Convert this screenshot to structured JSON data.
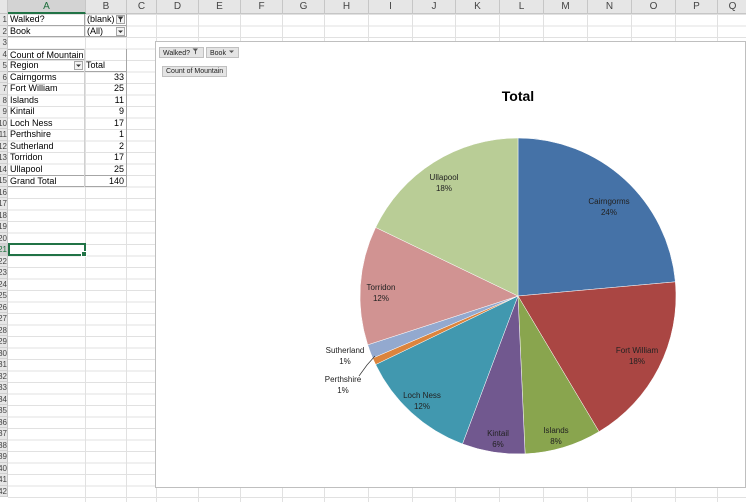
{
  "sheet": {
    "columns": [
      "A",
      "B",
      "C",
      "D",
      "E",
      "F",
      "G",
      "H",
      "I",
      "J",
      "K",
      "L",
      "M",
      "N",
      "O",
      "P",
      "Q"
    ],
    "selected_column": "A",
    "row_numbers": [
      "1",
      "2",
      "3",
      "4",
      "5",
      "6",
      "7",
      "8",
      "9",
      "10",
      "11",
      "12",
      "13",
      "14",
      "15",
      "16",
      "17",
      "18",
      "19",
      "20",
      "21",
      "22",
      "23",
      "24",
      "25",
      "26",
      "27",
      "28",
      "29",
      "30",
      "31",
      "32",
      "33",
      "34",
      "35",
      "36",
      "37",
      "38",
      "39",
      "40",
      "41",
      "42"
    ],
    "selected_row": "21"
  },
  "pivot": {
    "filters": [
      {
        "label": "Walked?",
        "value": "(blank)",
        "icon": "filter-funnel-icon"
      },
      {
        "label": "Book",
        "value": "(All)",
        "icon": "dropdown-arrow-icon"
      }
    ],
    "value_header": "Count of Mountain",
    "row_header": "Region",
    "total_header": "Total",
    "rows": [
      {
        "region": "Cairngorms",
        "total": "33"
      },
      {
        "region": "Fort William",
        "total": "25"
      },
      {
        "region": "Islands",
        "total": "11"
      },
      {
        "region": "Kintail",
        "total": "9"
      },
      {
        "region": "Loch Ness",
        "total": "17"
      },
      {
        "region": "Perthshire",
        "total": "1"
      },
      {
        "region": "Sutherland",
        "total": "2"
      },
      {
        "region": "Torridon",
        "total": "17"
      },
      {
        "region": "Ullapool",
        "total": "25"
      }
    ],
    "grand_total_label": "Grand Total",
    "grand_total": "140"
  },
  "chart": {
    "field_buttons": {
      "walked": "Walked?",
      "book": "Book",
      "values": "Count of Mountain"
    }
  },
  "chart_data": {
    "type": "pie",
    "title": "Total",
    "categories": [
      "Cairngorms",
      "Fort William",
      "Islands",
      "Kintail",
      "Loch Ness",
      "Perthshire",
      "Sutherland",
      "Torridon",
      "Ullapool"
    ],
    "values": [
      33,
      25,
      11,
      9,
      17,
      1,
      2,
      17,
      25
    ],
    "percent_labels": [
      "24%",
      "18%",
      "8%",
      "6%",
      "12%",
      "1%",
      "1%",
      "12%",
      "18%"
    ],
    "colors": [
      "#4572a7",
      "#aa4643",
      "#89a54e",
      "#71588f",
      "#4198af",
      "#db843d",
      "#93a9cf",
      "#d19392",
      "#b9cd96"
    ]
  }
}
